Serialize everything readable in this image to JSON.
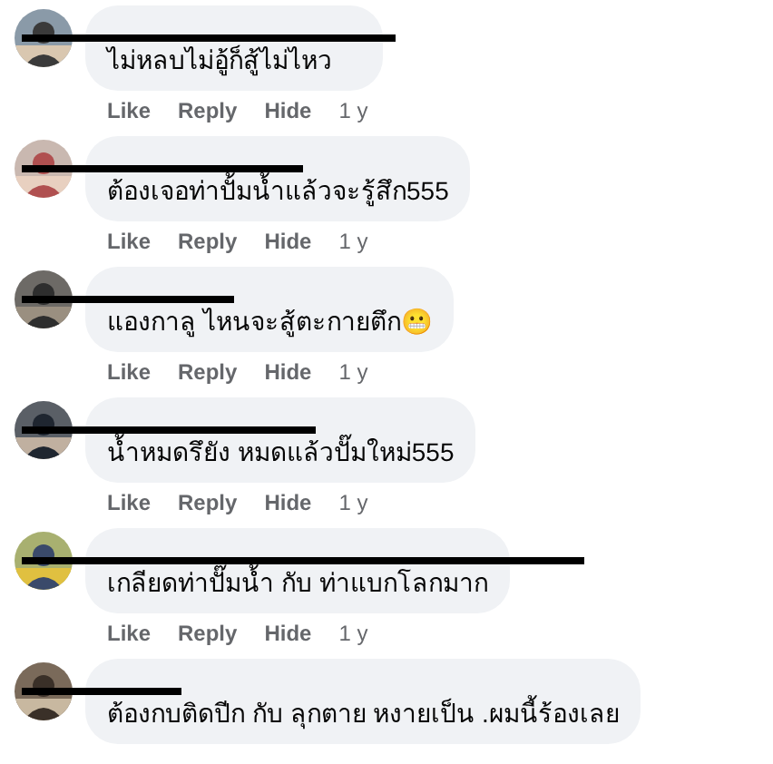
{
  "comments": [
    {
      "redacted": true,
      "text": "ไม่หลบไม่อู้ก็สู้ไม่ไหว",
      "actions": [
        "Like",
        "Reply",
        "Hide"
      ],
      "time": "1 y"
    },
    {
      "redacted": true,
      "text": "ต้องเจอท่าปั้มน้ำแล้วจะรู้สึก555",
      "actions": [
        "Like",
        "Reply",
        "Hide"
      ],
      "time": "1 y"
    },
    {
      "redacted": true,
      "text": "แองกาลู ไหนจะสู้ตะกายตึก😬",
      "actions": [
        "Like",
        "Reply",
        "Hide"
      ],
      "time": "1 y"
    },
    {
      "redacted": true,
      "text": "น้ำหมดรึยัง หมดแล้วปั๊มใหม่555",
      "actions": [
        "Like",
        "Reply",
        "Hide"
      ],
      "time": "1 y"
    },
    {
      "redacted": true,
      "text": "เกลียดท่าปั๊มน้ำ กับ ท่าแบกโลกมาก",
      "actions": [
        "Like",
        "Reply",
        "Hide"
      ],
      "time": "1 y"
    },
    {
      "redacted": true,
      "text": "ต้องกบติดปีก กับ ลุกตาย หงายเป็น .ผมนี้ร้องเลย"
    }
  ]
}
